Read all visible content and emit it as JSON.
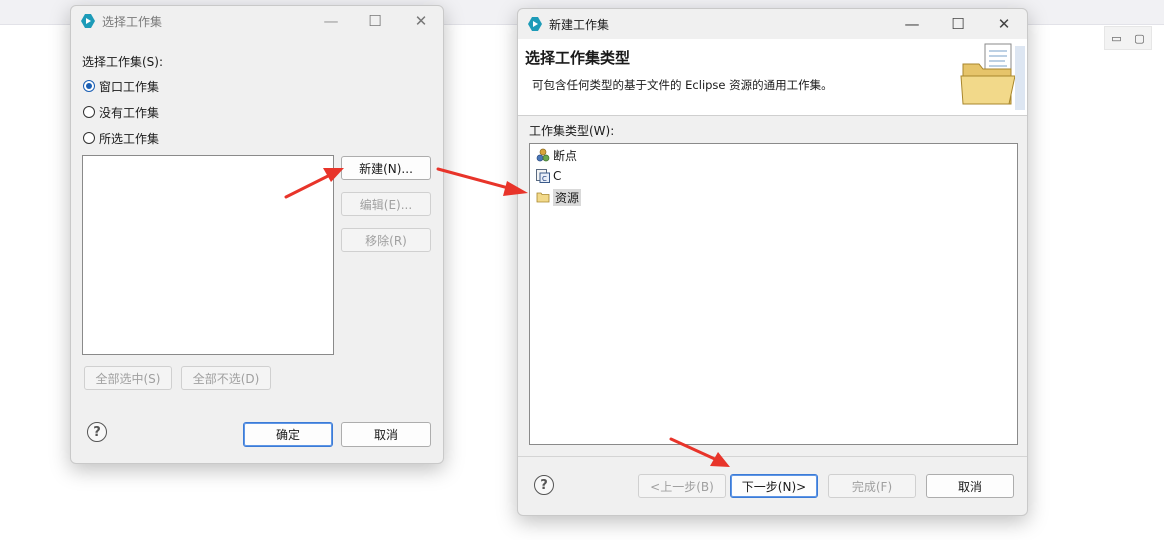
{
  "background": {
    "right_icons": [
      "▭",
      "▢"
    ]
  },
  "dialog1": {
    "title": "选择工作集",
    "section_label": "选择工作集(S):",
    "radios": [
      {
        "label": "窗口工作集",
        "checked": true
      },
      {
        "label": "没有工作集",
        "checked": false
      },
      {
        "label": "所选工作集",
        "checked": false
      }
    ],
    "buttons": {
      "new": "新建(N)...",
      "edit": "编辑(E)...",
      "remove": "移除(R)",
      "select_all": "全部选中(S)",
      "deselect_all": "全部不选(D)",
      "ok": "确定",
      "cancel": "取消"
    }
  },
  "dialog2": {
    "title": "新建工作集",
    "header_title": "选择工作集类型",
    "header_desc": "可包含任何类型的基于文件的 Eclipse 资源的通用工作集。",
    "types_label": "工作集类型(W):",
    "types": [
      {
        "label": "断点",
        "icon": "breakpoint-icon"
      },
      {
        "label": "C",
        "icon": "c-project-icon"
      },
      {
        "label": "资源",
        "icon": "resource-folder-icon",
        "selected": true
      }
    ],
    "buttons": {
      "back": "<上一步(B)",
      "next": "下一步(N)>",
      "finish": "完成(F)",
      "cancel": "取消"
    }
  },
  "window_controls": {
    "minimize": "—",
    "maximize": "☐",
    "close": "✕"
  },
  "colors": {
    "arrow": "#e8342a",
    "radio_selected": "#1a5fb4",
    "default_button_border": "#3c7bd6"
  }
}
